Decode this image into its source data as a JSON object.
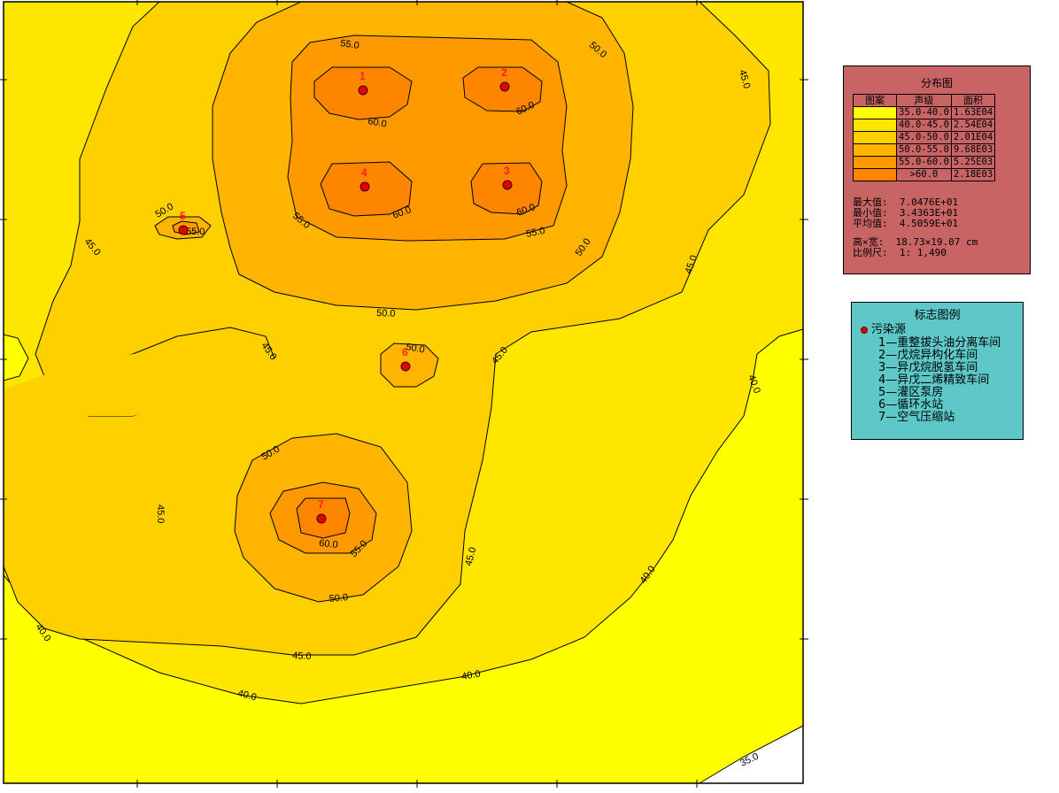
{
  "colors": {
    "lvl_35_40": "#ffff00",
    "lvl_40_45": "#fee600",
    "lvl_45_50": "#fed000",
    "lvl_50_55": "#feb400",
    "lvl_55_60": "#fe9a00",
    "lvl_60": "#fe8500",
    "source": "#e00000",
    "legend_dist_bg": "#c86464",
    "legend_marks_bg": "#5ec8c8"
  },
  "map": {
    "contour_labels": [
      "55.0",
      "50.0",
      "45.0",
      "60.0",
      "60.0",
      "60.0",
      "60.0",
      "55.0",
      "50.0",
      "50.0",
      "45.0",
      "50.0",
      "45.0",
      "45.0",
      "40.0",
      "50.0",
      "45.0",
      "60.0",
      "55.0",
      "50.0",
      "45.0",
      "40.0",
      "40.0",
      "40.0",
      "45.0",
      "40.0",
      "35.0",
      "50.0",
      "55.0",
      "60.0"
    ],
    "sources": [
      {
        "id": "1"
      },
      {
        "id": "2"
      },
      {
        "id": "3"
      },
      {
        "id": "4"
      },
      {
        "id": "5"
      },
      {
        "id": "6"
      },
      {
        "id": "7"
      }
    ]
  },
  "legend_distribution": {
    "title": "分布图",
    "headers": [
      "图案",
      "声级",
      "面积"
    ],
    "rows": [
      {
        "range": "35.0-40.0",
        "area": "1.63E04",
        "color": "#ffff00"
      },
      {
        "range": "40.0-45.0",
        "area": "2.54E04",
        "color": "#fee600"
      },
      {
        "range": "45.0-50.0",
        "area": "2.01E04",
        "color": "#fed000"
      },
      {
        "range": "50.0-55.0",
        "area": "9.68E03",
        "color": "#feb400"
      },
      {
        "range": "55.0-60.0",
        "area": "5.25E03",
        "color": "#fe9a00"
      },
      {
        "range": ">60.0",
        "area": "2.18E03",
        "color": "#fe8500"
      }
    ],
    "max_label": "最大值:",
    "max_value": "7.0476E+01",
    "min_label": "最小值:",
    "min_value": "3.4363E+01",
    "avg_label": "平均值:",
    "avg_value": "4.5059E+01",
    "size_label": "高×宽:",
    "size_value": "18.73×19.07 cm",
    "scale_label": "比例尺:",
    "scale_value": "1: 1,490"
  },
  "legend_marks": {
    "title": "标志图例",
    "source_label": "污染源",
    "items": [
      "1—重整拔头油分离车间",
      "2—戊烷异构化车间",
      "3—异戊烷脱氢车间",
      "4—异戊二烯精致车间",
      "5—灌区泵房",
      "6—循环水站",
      "7—空气压缩站"
    ]
  }
}
